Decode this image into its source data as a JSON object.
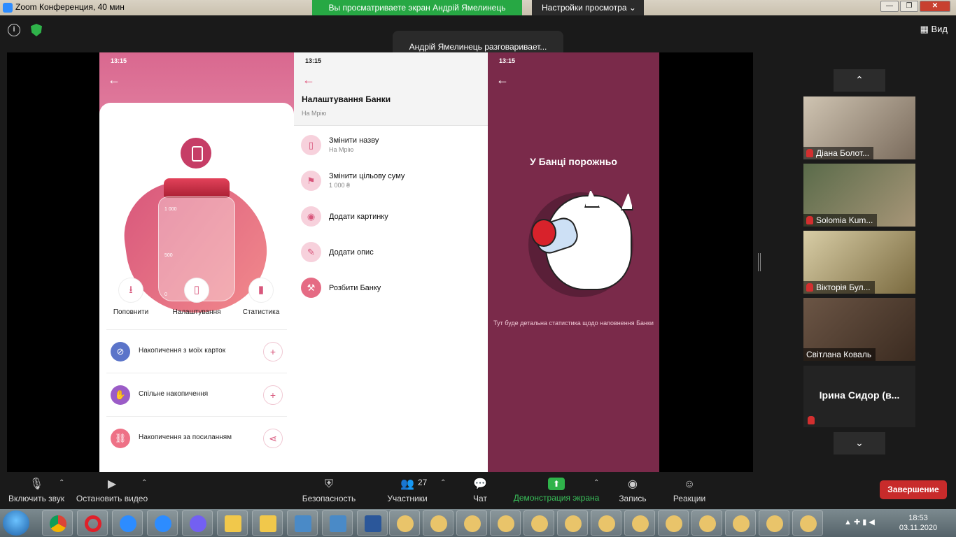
{
  "window": {
    "title": "Zoom Конференция, 40 мин",
    "share_banner": "Вы просматриваете экран Андрій Ямелинець",
    "view_options": "Настройки просмотра ⌄",
    "controls": {
      "minimize": "—",
      "restore": "❐",
      "close": "✕"
    }
  },
  "zoom_top": {
    "speaker": "Андрій Ямелинець разговаривает...",
    "view_label": "Вид"
  },
  "phone1": {
    "status_time": "13:15",
    "jar_marks": [
      "1 000",
      "500",
      "0"
    ],
    "actions": [
      {
        "label": "Поповнити",
        "icon": "⭳"
      },
      {
        "label": "Налаштування",
        "icon": "▯"
      },
      {
        "label": "Статистика",
        "icon": "▮"
      }
    ],
    "list": [
      {
        "label": "Накопичення з моїх карток",
        "color": "#5b74c9"
      },
      {
        "label": "Спільне накопичення",
        "color": "#9b5cc7"
      },
      {
        "label": "Накопичення за посиланням",
        "color": "#ee7186"
      }
    ]
  },
  "phone2": {
    "status_time": "13:15",
    "title": "Налаштування Банки",
    "subtitle": "На Мрію",
    "rows": [
      {
        "label": "Змінити назву",
        "value": "На Мрію"
      },
      {
        "label": "Змінити цільову суму",
        "value": "1 000 ₴"
      },
      {
        "label": "Додати картинку",
        "value": ""
      },
      {
        "label": "Додати опис",
        "value": ""
      },
      {
        "label": "Розбити Банку",
        "value": ""
      }
    ]
  },
  "phone3": {
    "status_time": "13:15",
    "title": "У Банці порожньо",
    "description": "Тут буде детальна статистика щодо наповнення Банки"
  },
  "participants": [
    {
      "name": "Діана Болот...",
      "muted": true
    },
    {
      "name": "Solomia Kum...",
      "muted": true
    },
    {
      "name": "Вікторія Бул...",
      "muted": true
    },
    {
      "name": "Світлана Коваль",
      "muted": false
    }
  ],
  "text_tile": {
    "name": "Ірина Сидор (в...",
    "muted": true
  },
  "toolbar": {
    "mute": "Включить звук",
    "video": "Остановить видео",
    "security": "Безопасность",
    "participants": "Участники",
    "participants_count": "27",
    "chat": "Чат",
    "share": "Демонстрация экрана",
    "record": "Запись",
    "reactions": "Реакции",
    "end": "Завершение"
  },
  "taskbar": {
    "time": "18:53",
    "date": "03.11.2020"
  }
}
